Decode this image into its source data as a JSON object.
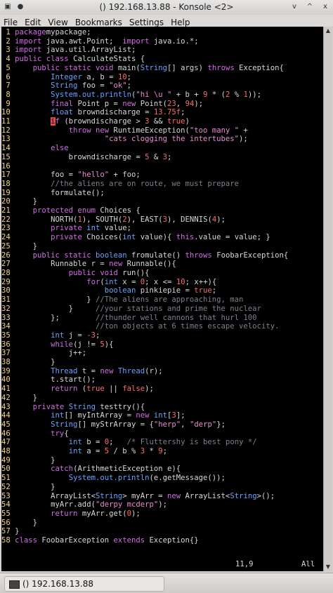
{
  "window": {
    "title": "() 192.168.13.88 - Konsole <2>",
    "controls": [
      "v",
      "^",
      "x"
    ]
  },
  "menubar": [
    "File",
    "Edit",
    "View",
    "Bookmarks",
    "Settings",
    "Help"
  ],
  "editor": {
    "cursor_position": "11,9",
    "scroll_position": "All",
    "lines": [
      {
        "n": "1",
        "tokens": [
          [
            "k",
            "package"
          ],
          [
            "",
            "mypackage;"
          ]
        ]
      },
      {
        "n": "2",
        "tokens": [
          [
            "k",
            "import"
          ],
          [
            "",
            " java.awt.Point;  "
          ],
          [
            "k",
            "import"
          ],
          [
            "",
            " java.io.*;"
          ]
        ]
      },
      {
        "n": "3",
        "tokens": [
          [
            "k",
            "import"
          ],
          [
            "",
            " java.util.ArrayList;"
          ]
        ]
      },
      {
        "n": "4",
        "tokens": [
          [
            "k",
            "public class"
          ],
          [
            "",
            " CalculateStats {"
          ]
        ]
      },
      {
        "n": "5",
        "tokens": [
          [
            "",
            "    "
          ],
          [
            "k",
            "public static void"
          ],
          [
            "",
            " main("
          ],
          [
            "t",
            "String"
          ],
          [
            "",
            "[] args) "
          ],
          [
            "k",
            "throws"
          ],
          [
            "",
            " Exception{"
          ]
        ]
      },
      {
        "n": "6",
        "tokens": [
          [
            "",
            "        "
          ],
          [
            "t",
            "Integer"
          ],
          [
            "",
            " a, b = "
          ],
          [
            "n",
            "10"
          ],
          [
            "",
            ";"
          ]
        ]
      },
      {
        "n": "7",
        "tokens": [
          [
            "",
            "        "
          ],
          [
            "t",
            "String"
          ],
          [
            "",
            " foo = "
          ],
          [
            "s",
            "\"ok\""
          ],
          [
            "",
            ";"
          ]
        ]
      },
      {
        "n": "8",
        "tokens": [
          [
            "",
            "        "
          ],
          [
            "t",
            "System.out.println"
          ],
          [
            "",
            "("
          ],
          [
            "s",
            "\"hi \\u \""
          ],
          [
            "",
            " + b + "
          ],
          [
            "n",
            "9"
          ],
          [
            "",
            " * ("
          ],
          [
            "n",
            "2"
          ],
          [
            "",
            " % "
          ],
          [
            "n",
            "1"
          ],
          [
            "",
            "));"
          ]
        ]
      },
      {
        "n": "9",
        "tokens": [
          [
            "",
            "        "
          ],
          [
            "k",
            "final"
          ],
          [
            "",
            " Point p = "
          ],
          [
            "k",
            "new"
          ],
          [
            "",
            " Point("
          ],
          [
            "n",
            "23"
          ],
          [
            "",
            ", "
          ],
          [
            "n",
            "94"
          ],
          [
            "",
            ");"
          ]
        ]
      },
      {
        "n": "10",
        "tokens": [
          [
            "",
            "        "
          ],
          [
            "t",
            "float"
          ],
          [
            "",
            " browndischarge = "
          ],
          [
            "n",
            "13.75f"
          ],
          [
            "",
            ";"
          ]
        ]
      },
      {
        "n": "11",
        "tokens": [
          [
            "",
            "        "
          ],
          [
            "cur",
            "i"
          ],
          [
            "k",
            "f"
          ],
          [
            "",
            " (browndischarge > "
          ],
          [
            "n",
            "3"
          ],
          [
            "",
            " && "
          ],
          [
            "n",
            "true"
          ],
          [
            "",
            ")"
          ]
        ]
      },
      {
        "n": "12",
        "tokens": [
          [
            "",
            "            "
          ],
          [
            "k",
            "throw"
          ],
          [
            "",
            " "
          ],
          [
            "k",
            "new"
          ],
          [
            "",
            " RuntimeException("
          ],
          [
            "s",
            "\"too many \""
          ],
          [
            "",
            " +"
          ]
        ]
      },
      {
        "n": "13",
        "tokens": [
          [
            "",
            "                    "
          ],
          [
            "s",
            "\"cats clogging the intertubes\""
          ],
          [
            "",
            ");"
          ]
        ]
      },
      {
        "n": "14",
        "tokens": [
          [
            "",
            "        "
          ],
          [
            "k",
            "else"
          ]
        ]
      },
      {
        "n": "15",
        "tokens": [
          [
            "",
            "            browndischarge = "
          ],
          [
            "n",
            "5"
          ],
          [
            "",
            " & "
          ],
          [
            "n",
            "3"
          ],
          [
            "",
            ";"
          ]
        ]
      },
      {
        "n": "16",
        "tokens": []
      },
      {
        "n": "17",
        "tokens": [
          [
            "",
            "        foo = "
          ],
          [
            "s",
            "\"hello\""
          ],
          [
            "",
            " + foo;"
          ]
        ]
      },
      {
        "n": "18",
        "tokens": [
          [
            "",
            "        "
          ],
          [
            "c",
            "//the aliens are on route, we must prepare"
          ]
        ]
      },
      {
        "n": "19",
        "tokens": [
          [
            "",
            "        formulate();"
          ]
        ]
      },
      {
        "n": "20",
        "tokens": [
          [
            "",
            "    }"
          ]
        ]
      },
      {
        "n": "21",
        "tokens": [
          [
            "",
            "    "
          ],
          [
            "k",
            "protected enum"
          ],
          [
            "",
            " Choices {"
          ]
        ]
      },
      {
        "n": "22",
        "tokens": [
          [
            "",
            "        NORTH("
          ],
          [
            "n",
            "1"
          ],
          [
            "",
            "), SOUTH("
          ],
          [
            "n",
            "2"
          ],
          [
            "",
            "), EAST("
          ],
          [
            "n",
            "3"
          ],
          [
            "",
            "), DENNIS("
          ],
          [
            "n",
            "4"
          ],
          [
            "",
            ");"
          ]
        ]
      },
      {
        "n": "23",
        "tokens": [
          [
            "",
            "        "
          ],
          [
            "k",
            "private"
          ],
          [
            "",
            " "
          ],
          [
            "t",
            "int"
          ],
          [
            "",
            " value;"
          ]
        ]
      },
      {
        "n": "24",
        "tokens": [
          [
            "",
            "        "
          ],
          [
            "k",
            "private"
          ],
          [
            "",
            " Choices("
          ],
          [
            "t",
            "int"
          ],
          [
            "",
            " value){ "
          ],
          [
            "k",
            "this"
          ],
          [
            "",
            ".value = value; }"
          ]
        ]
      },
      {
        "n": "25",
        "tokens": [
          [
            "",
            "    }"
          ]
        ]
      },
      {
        "n": "26",
        "tokens": [
          [
            "",
            "    "
          ],
          [
            "k",
            "public static"
          ],
          [
            "",
            " "
          ],
          [
            "t",
            "boolean"
          ],
          [
            "",
            " fromulate() "
          ],
          [
            "k",
            "throws"
          ],
          [
            "",
            " FoobarException{"
          ]
        ]
      },
      {
        "n": "27",
        "tokens": [
          [
            "",
            "        Runnable r = "
          ],
          [
            "k",
            "new"
          ],
          [
            "",
            " Runnable(){"
          ]
        ]
      },
      {
        "n": "28",
        "tokens": [
          [
            "",
            "            "
          ],
          [
            "k",
            "public void"
          ],
          [
            "",
            " run(){"
          ]
        ]
      },
      {
        "n": "29",
        "tokens": [
          [
            "",
            "                "
          ],
          [
            "k",
            "for"
          ],
          [
            "",
            "("
          ],
          [
            "t",
            "int"
          ],
          [
            "",
            " x = "
          ],
          [
            "n",
            "0"
          ],
          [
            "",
            "; x <= "
          ],
          [
            "n",
            "10"
          ],
          [
            "",
            "; x++){"
          ]
        ]
      },
      {
        "n": "30",
        "tokens": [
          [
            "",
            "                    "
          ],
          [
            "t",
            "boolean"
          ],
          [
            "",
            " pinkiepie = "
          ],
          [
            "n",
            "true"
          ],
          [
            "",
            ";"
          ]
        ]
      },
      {
        "n": "31",
        "tokens": [
          [
            "",
            "                } "
          ],
          [
            "c",
            "//The aliens are approaching, man"
          ]
        ]
      },
      {
        "n": "32",
        "tokens": [
          [
            "",
            "            }     "
          ],
          [
            "c",
            "//your stations and prime the nuclear"
          ]
        ]
      },
      {
        "n": "33",
        "tokens": [
          [
            "",
            "        };        "
          ],
          [
            "c",
            "//thunder well cannons that hurl 100"
          ]
        ]
      },
      {
        "n": "34",
        "tokens": [
          [
            "",
            "                  "
          ],
          [
            "c",
            "//ton objects at 6 times escape velocity."
          ]
        ]
      },
      {
        "n": "35",
        "tokens": [
          [
            "",
            "        "
          ],
          [
            "t",
            "int"
          ],
          [
            "",
            " j = "
          ],
          [
            "n",
            "-3"
          ],
          [
            "",
            ";"
          ]
        ]
      },
      {
        "n": "36",
        "tokens": [
          [
            "",
            "        "
          ],
          [
            "k",
            "while"
          ],
          [
            "",
            "(j != "
          ],
          [
            "n",
            "5"
          ],
          [
            "",
            "){"
          ]
        ]
      },
      {
        "n": "37",
        "tokens": [
          [
            "",
            "            j++;"
          ]
        ]
      },
      {
        "n": "38",
        "tokens": [
          [
            "",
            "        }"
          ]
        ]
      },
      {
        "n": "39",
        "tokens": [
          [
            "",
            "        "
          ],
          [
            "t",
            "Thread"
          ],
          [
            "",
            " t = "
          ],
          [
            "k",
            "new"
          ],
          [
            "",
            " "
          ],
          [
            "t",
            "Thread"
          ],
          [
            "",
            "(r);"
          ]
        ]
      },
      {
        "n": "40",
        "tokens": [
          [
            "",
            "        t.start();"
          ]
        ]
      },
      {
        "n": "41",
        "tokens": [
          [
            "",
            "        "
          ],
          [
            "k",
            "return"
          ],
          [
            "",
            " ("
          ],
          [
            "n",
            "true"
          ],
          [
            "",
            " || "
          ],
          [
            "n",
            "false"
          ],
          [
            "",
            ");"
          ]
        ]
      },
      {
        "n": "42",
        "tokens": [
          [
            "",
            "    }"
          ]
        ]
      },
      {
        "n": "43",
        "tokens": [
          [
            "",
            "    "
          ],
          [
            "k",
            "private"
          ],
          [
            "",
            " "
          ],
          [
            "t",
            "String"
          ],
          [
            "",
            " testtry(){"
          ]
        ]
      },
      {
        "n": "44",
        "tokens": [
          [
            "",
            "        "
          ],
          [
            "t",
            "int"
          ],
          [
            "",
            "[] myIntArray = "
          ],
          [
            "k",
            "new"
          ],
          [
            "",
            " "
          ],
          [
            "t",
            "int"
          ],
          [
            "",
            "["
          ],
          [
            "n",
            "3"
          ],
          [
            "",
            "];"
          ]
        ]
      },
      {
        "n": "45",
        "tokens": [
          [
            "",
            "        "
          ],
          [
            "t",
            "String"
          ],
          [
            "",
            "[] myStrArray = {"
          ],
          [
            "s",
            "\"herp\""
          ],
          [
            "",
            ", "
          ],
          [
            "s",
            "\"derp\""
          ],
          [
            "",
            "};"
          ]
        ]
      },
      {
        "n": "46",
        "tokens": [
          [
            "",
            "        "
          ],
          [
            "k",
            "try"
          ],
          [
            "",
            "{"
          ]
        ]
      },
      {
        "n": "47",
        "tokens": [
          [
            "",
            "            "
          ],
          [
            "t",
            "int"
          ],
          [
            "",
            " b = "
          ],
          [
            "n",
            "0"
          ],
          [
            "",
            ";   "
          ],
          [
            "c",
            "/* Fluttershy is best pony */"
          ]
        ]
      },
      {
        "n": "48",
        "tokens": [
          [
            "",
            "            "
          ],
          [
            "t",
            "int"
          ],
          [
            "",
            " a = "
          ],
          [
            "n",
            "5"
          ],
          [
            "",
            " / b % "
          ],
          [
            "n",
            "3"
          ],
          [
            "",
            " * "
          ],
          [
            "n",
            "9"
          ],
          [
            "",
            ";"
          ]
        ]
      },
      {
        "n": "49",
        "tokens": [
          [
            "",
            "        }"
          ]
        ]
      },
      {
        "n": "50",
        "tokens": [
          [
            "",
            "        "
          ],
          [
            "k",
            "catch"
          ],
          [
            "",
            "(ArithmeticException e){"
          ]
        ]
      },
      {
        "n": "51",
        "tokens": [
          [
            "",
            "            "
          ],
          [
            "t",
            "System.out.println"
          ],
          [
            "",
            "(e.getMessage());"
          ]
        ]
      },
      {
        "n": "52",
        "tokens": [
          [
            "",
            "        }"
          ]
        ]
      },
      {
        "n": "53",
        "tokens": [
          [
            "",
            "        ArrayList<"
          ],
          [
            "t",
            "String"
          ],
          [
            "",
            "> myArr = "
          ],
          [
            "k",
            "new"
          ],
          [
            "",
            " ArrayList<"
          ],
          [
            "t",
            "String"
          ],
          [
            "",
            ">();"
          ]
        ]
      },
      {
        "n": "54",
        "tokens": [
          [
            "",
            "        myArr.add("
          ],
          [
            "s",
            "\"derpy mcderp\""
          ],
          [
            "",
            ");"
          ]
        ]
      },
      {
        "n": "55",
        "tokens": [
          [
            "",
            "        "
          ],
          [
            "k",
            "return"
          ],
          [
            "",
            " myArr.get("
          ],
          [
            "n",
            "0"
          ],
          [
            "",
            ");"
          ]
        ]
      },
      {
        "n": "56",
        "tokens": [
          [
            "",
            "    }"
          ]
        ]
      },
      {
        "n": "57",
        "tokens": [
          [
            "",
            "}"
          ]
        ]
      },
      {
        "n": "58",
        "tokens": [
          [
            "k",
            "class"
          ],
          [
            "",
            " FoobarException "
          ],
          [
            "k",
            "extends"
          ],
          [
            "",
            " Exception{}"
          ]
        ]
      }
    ]
  },
  "taskbar": {
    "item_label": "() 192.168.13.88"
  }
}
